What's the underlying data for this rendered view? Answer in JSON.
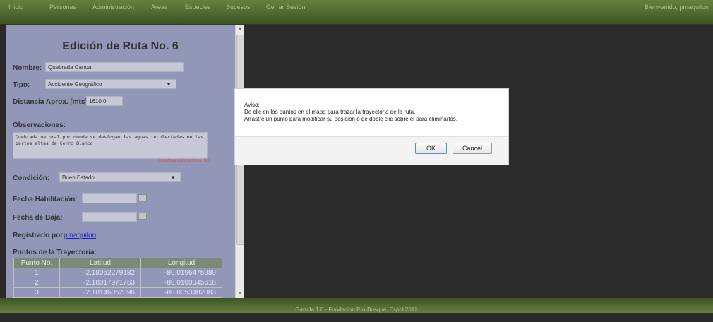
{
  "nav": {
    "items": [
      "Inicio",
      "Personas",
      "Administración",
      "Áreas",
      "Especies",
      "Sucesos",
      "Cerrar Sesión"
    ],
    "welcome": "Bienvenido, pmaquilon"
  },
  "form": {
    "title": "Edición de Ruta No. 6",
    "nombre_label": "Nombre:",
    "nombre_value": "Quebrada Canoa",
    "tipo_label": "Tipo:",
    "tipo_value": "Accidente Geográfico",
    "distancia_label": "Distancia Aprox. [mts]:",
    "distancia_value": "1610.0",
    "observaciones_label": "Observaciones:",
    "observaciones_value": "Quebrada natural por donde se desfogan las aguas recolectadas en las partes altas de Cerro Blanco",
    "chars_available": "Caracteres disponibles: 380",
    "condicion_label": "Condición:",
    "condicion_value": "Buen Estado",
    "fecha_habilitacion_label": "Fecha Habilitación:",
    "fecha_baja_label": "Fecha de Baja:",
    "registrado_label": "Registrado por:",
    "registrado_value": "pmaquilon",
    "puntos_label": "Puntos de la Trayectoria:"
  },
  "points_table": {
    "headers": [
      "Punto No.",
      "Latitud",
      "Longitud"
    ],
    "rows": [
      [
        "1",
        "-2.18052279182",
        "-80.0196475989"
      ],
      [
        "2",
        "-2.18017971763",
        "-80.0100345618"
      ],
      [
        "3",
        "-2.18146052896",
        "-80.0053482083"
      ]
    ]
  },
  "dialog": {
    "line1": "Aviso:",
    "line2": "De clic en los puntos en el mapa para trazar la trayectoria de la ruta.",
    "line3": "Arrastre un punto para modificar su posición o dé doble clic sobre él para eliminarlos.",
    "ok": "OK",
    "cancel": "Cancel"
  },
  "footer": {
    "text": "Garuda 1.0 - Fundacion Pro-Bosque, Espol 2012"
  }
}
